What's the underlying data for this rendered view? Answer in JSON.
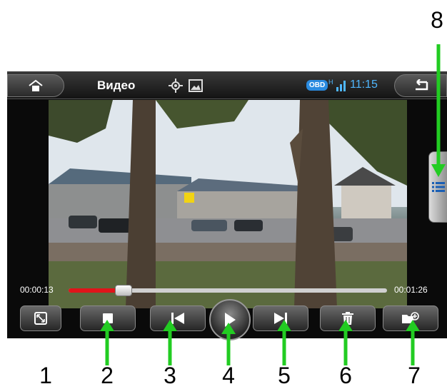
{
  "statusbar": {
    "title": "Видео",
    "obd_badge": "OBD",
    "signal_type": "H",
    "time": "11:15"
  },
  "player": {
    "elapsed": "00:00:13",
    "duration": "00:01:26",
    "progress": 0.17
  },
  "icons": {
    "home": "home-icon",
    "back": "back-icon",
    "gps": "gps-icon",
    "image": "image-icon",
    "list": "list-icon",
    "fullscreen": "fullscreen-icon",
    "stop": "stop-icon",
    "previous": "previous-icon",
    "play": "play-icon",
    "next": "next-icon",
    "delete": "trash-icon",
    "add_folder": "folder-add-icon"
  },
  "annotations": {
    "arrow_color": "#22cc22",
    "labels": [
      "1",
      "2",
      "3",
      "4",
      "5",
      "6",
      "7",
      "8"
    ]
  }
}
